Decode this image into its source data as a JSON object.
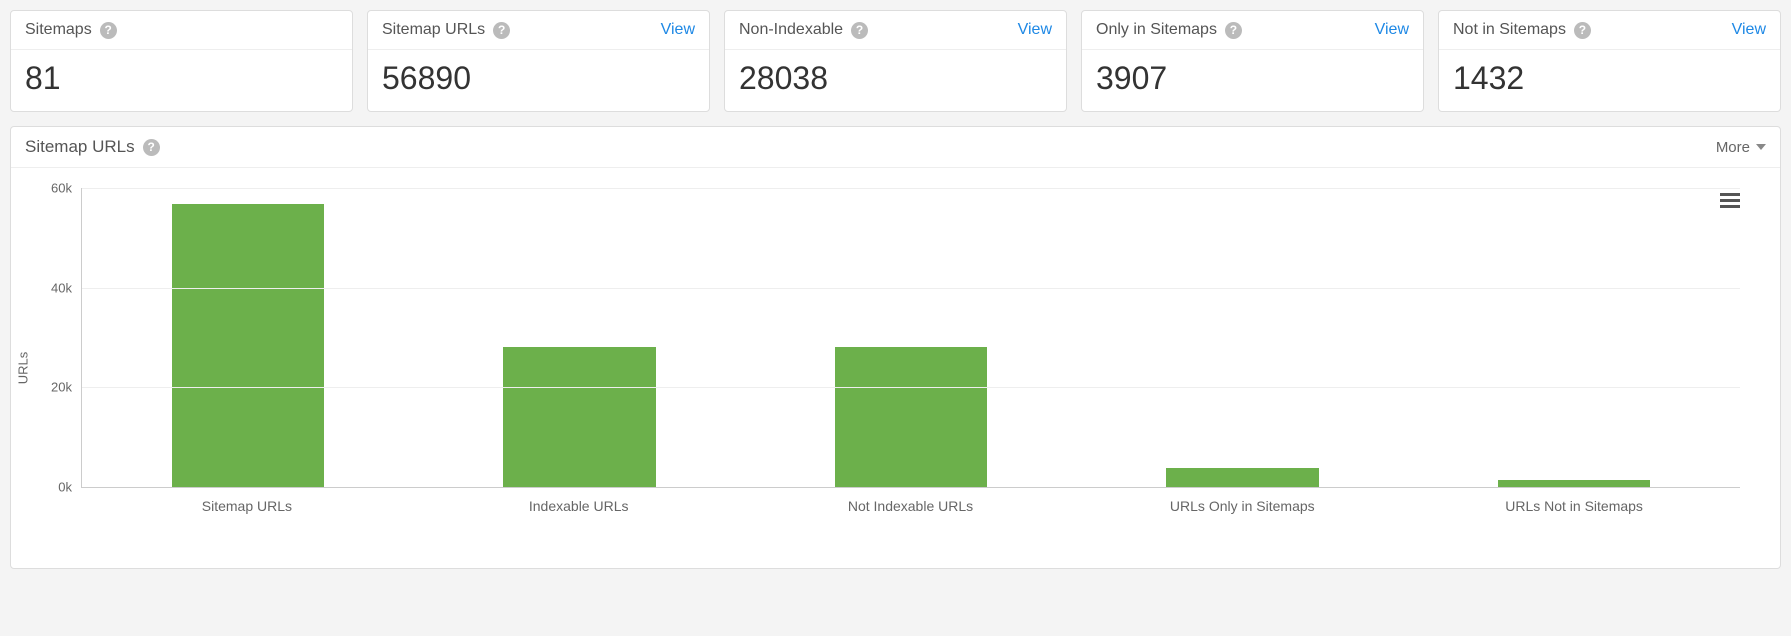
{
  "cards": [
    {
      "label": "Sitemaps",
      "value": "81",
      "view": null
    },
    {
      "label": "Sitemap URLs",
      "value": "56890",
      "view": "View"
    },
    {
      "label": "Non-Indexable",
      "value": "28038",
      "view": "View"
    },
    {
      "label": "Only in Sitemaps",
      "value": "3907",
      "view": "View"
    },
    {
      "label": "Not in Sitemaps",
      "value": "1432",
      "view": "View"
    }
  ],
  "panel": {
    "title": "Sitemap URLs",
    "more": "More"
  },
  "chart_data": {
    "type": "bar",
    "categories": [
      "Sitemap URLs",
      "Indexable URLs",
      "Not Indexable URLs",
      "URLs Only in Sitemaps",
      "URLs Not in Sitemaps"
    ],
    "values": [
      56890,
      28000,
      28038,
      3907,
      1432
    ],
    "title": "",
    "xlabel": "",
    "ylabel": "URLs",
    "ylim": [
      0,
      60000
    ],
    "yticks": [
      0,
      20000,
      40000,
      60000
    ],
    "ytick_labels": [
      "0k",
      "20k",
      "40k",
      "60k"
    ]
  }
}
